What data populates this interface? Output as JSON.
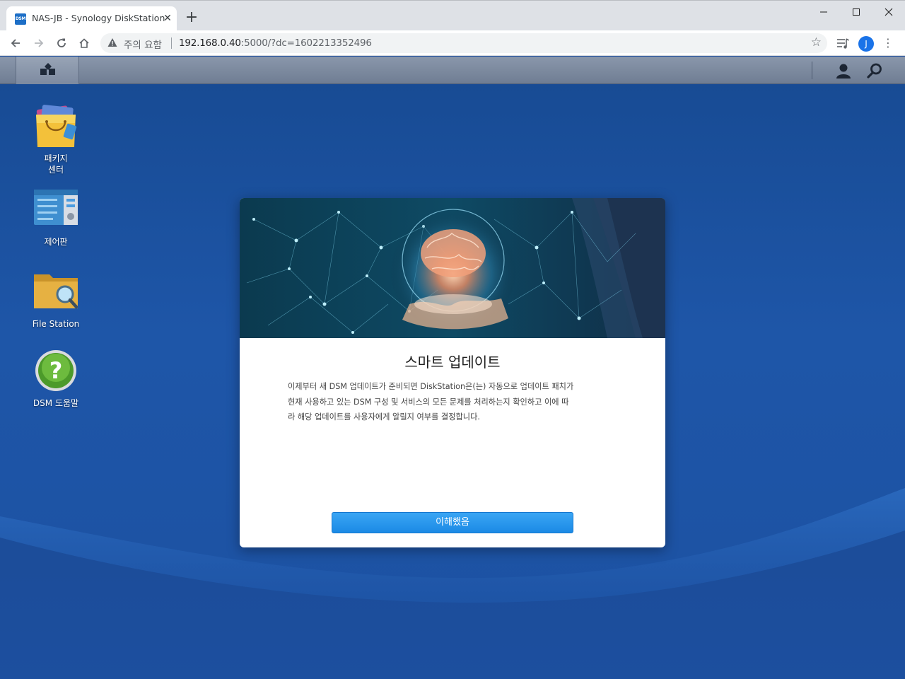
{
  "browser": {
    "tab": {
      "favicon_text": "DSM",
      "title": "NAS-JB - Synology DiskStation"
    },
    "address": {
      "security_label": "주의 요함",
      "url_host": "192.168.0.40",
      "url_rest": ":5000/?dc=1602213352496"
    },
    "profile_initial": "J"
  },
  "desktop": {
    "icons": [
      {
        "label": "패키지\n센터",
        "icon": "package-center-icon"
      },
      {
        "label": "제어판",
        "icon": "control-panel-icon"
      },
      {
        "label": "File Station",
        "icon": "file-station-icon"
      },
      {
        "label": "DSM 도움말",
        "icon": "dsm-help-icon"
      }
    ]
  },
  "dialog": {
    "title": "스마트 업데이트",
    "body_lines": [
      "이제부터 새 DSM 업데이트가 준비되면 DiskStation은(는) 자동으로 업데이트 패치가",
      "현재 사용하고 있는 DSM 구성 및 서비스의 모든 문제를 처리하는지 확인하고 이에 따",
      "라 해당 업데이트를 사용자에게 알릴지 여부를 결정합니다."
    ],
    "button_label": "이해했음"
  },
  "colors": {
    "desktop_bg": "#1e56a8",
    "taskbar": "#7d8aa0",
    "button_blue": "#1b8ae5"
  }
}
